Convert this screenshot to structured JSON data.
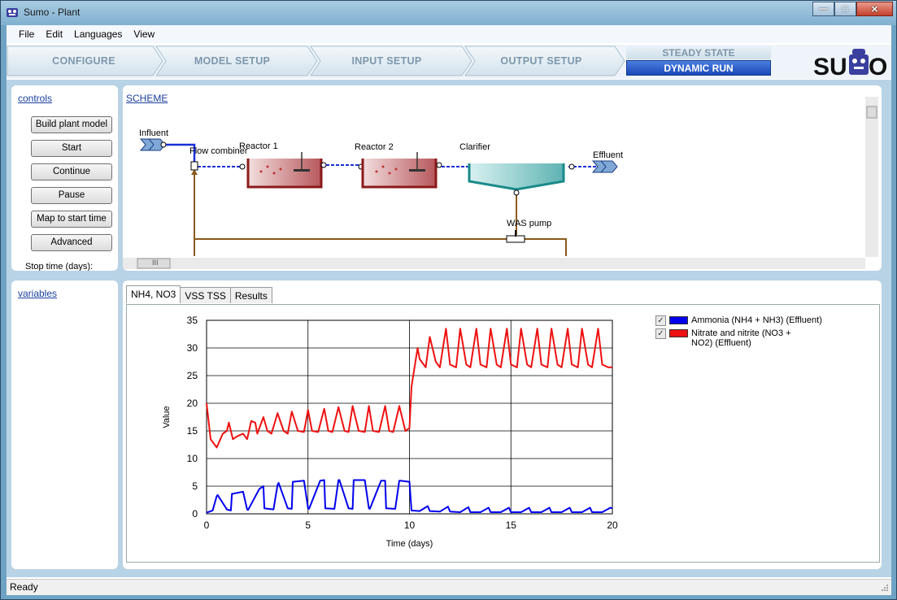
{
  "window": {
    "title": "Sumo - Plant",
    "controls": [
      "minimize",
      "maximize",
      "close"
    ]
  },
  "menu": [
    "File",
    "Edit",
    "Languages",
    "View"
  ],
  "steps": {
    "configure": "CONFIGURE",
    "model_setup": "MODEL SETUP",
    "input_setup": "INPUT SETUP",
    "output_setup": "OUTPUT SETUP",
    "steady_state": "STEADY STATE",
    "dynamic_run": "DYNAMIC RUN"
  },
  "controls": {
    "title": "controls",
    "buttons": [
      "Build plant model",
      "Start",
      "Continue",
      "Pause",
      "Map to start time",
      "Advanced"
    ],
    "stop_time_label": "Stop time (days):"
  },
  "scheme": {
    "title": "SCHEME",
    "labels": {
      "influent": "Influent",
      "flow_combiner": "Flow combiner",
      "reactor1": "Reactor 1",
      "reactor2": "Reactor 2",
      "clarifier": "Clarifier",
      "effluent": "Effluent",
      "was_pump": "WAS pump"
    },
    "scroll_thumb": "III"
  },
  "variables": {
    "title": "variables"
  },
  "plot_tabs": [
    "NH4, NO3",
    "VSS TSS",
    "Results"
  ],
  "colors": {
    "ammonia": "#0000ee",
    "nitrate": "#ee1111",
    "accent": "#1b48b6"
  },
  "chart_data": {
    "type": "line",
    "xlabel": "Time (days)",
    "ylabel": "Value",
    "xlim": [
      0,
      20
    ],
    "ylim": [
      0,
      35
    ],
    "xticks": [
      0,
      5,
      10,
      15,
      20
    ],
    "yticks": [
      0,
      5,
      10,
      15,
      20,
      25,
      30,
      35
    ],
    "grid": true,
    "legend_position": "right",
    "series": [
      {
        "name": "Ammonia (NH4 + NH3) (Effluent)",
        "color": "#0000ee",
        "x": [
          0,
          0.3,
          0.5,
          0.55,
          1.0,
          1.2,
          1.25,
          1.8,
          2.0,
          2.05,
          2.6,
          2.8,
          2.85,
          3.3,
          3.5,
          3.55,
          4.0,
          4.2,
          4.25,
          4.8,
          5.0,
          5.05,
          5.6,
          5.8,
          5.85,
          6.3,
          6.5,
          6.55,
          7.0,
          7.2,
          7.25,
          7.8,
          8.0,
          8.05,
          8.6,
          8.8,
          8.85,
          9.3,
          9.5,
          9.55,
          10.0,
          10.1,
          10.5,
          10.9,
          11.0,
          11.5,
          11.9,
          12.0,
          12.5,
          12.9,
          13.0,
          13.5,
          13.9,
          14.0,
          14.5,
          14.9,
          15.0,
          15.5,
          15.9,
          16.0,
          16.5,
          16.9,
          17.0,
          17.5,
          17.9,
          18.0,
          18.5,
          18.9,
          19.0,
          19.5,
          19.9,
          20.0
        ],
        "y": [
          0.2,
          0.6,
          3.2,
          3.4,
          0.8,
          0.6,
          3.6,
          4.0,
          0.8,
          0.7,
          4.5,
          5.0,
          1.0,
          0.8,
          5.2,
          5.6,
          1.0,
          0.9,
          5.8,
          6.0,
          1.0,
          0.9,
          6.0,
          6.1,
          1.0,
          0.9,
          6.1,
          6.1,
          1.0,
          0.9,
          6.1,
          6.1,
          1.0,
          0.9,
          6.0,
          6.0,
          1.0,
          0.9,
          6.0,
          6.0,
          5.8,
          0.6,
          0.5,
          1.4,
          0.5,
          0.4,
          1.3,
          0.4,
          0.3,
          1.2,
          0.3,
          0.3,
          1.1,
          0.3,
          0.3,
          1.1,
          0.3,
          0.3,
          1.1,
          0.3,
          0.3,
          1.1,
          0.3,
          0.3,
          1.1,
          0.3,
          0.3,
          1.1,
          0.3,
          0.3,
          1.1,
          1.0
        ]
      },
      {
        "name": "Nitrate and nitrite (NO3 + NO2) (Effluent)",
        "color": "#ee1111",
        "x": [
          0,
          0.2,
          0.5,
          0.8,
          1.0,
          1.1,
          1.3,
          1.5,
          1.8,
          2.0,
          2.2,
          2.4,
          2.5,
          2.8,
          3.0,
          3.2,
          3.5,
          3.8,
          4.0,
          4.2,
          4.5,
          4.8,
          5.0,
          5.2,
          5.5,
          5.8,
          6.0,
          6.2,
          6.5,
          6.8,
          7.0,
          7.2,
          7.5,
          7.8,
          8.0,
          8.2,
          8.5,
          8.8,
          9.0,
          9.2,
          9.5,
          9.8,
          10.0,
          10.1,
          10.4,
          10.5,
          10.8,
          11.0,
          11.3,
          11.5,
          11.8,
          12.0,
          12.3,
          12.5,
          12.8,
          13.0,
          13.3,
          13.5,
          13.8,
          14.0,
          14.3,
          14.5,
          14.8,
          15.0,
          15.3,
          15.5,
          15.8,
          16.0,
          16.3,
          16.5,
          16.8,
          17.0,
          17.3,
          17.5,
          17.8,
          18.0,
          18.3,
          18.5,
          18.8,
          19.0,
          19.3,
          19.5,
          19.8,
          20.0
        ],
        "y": [
          20,
          13.5,
          12,
          14.5,
          15,
          16.5,
          13.5,
          14,
          14.5,
          13.5,
          16.8,
          16.5,
          14.5,
          17.5,
          15,
          14.5,
          18.2,
          15,
          14.5,
          18.5,
          15,
          14.8,
          18.8,
          15,
          14.8,
          19,
          15,
          14.8,
          19.3,
          15,
          14.8,
          19.5,
          15,
          14.8,
          19.5,
          15,
          14.8,
          19.5,
          15,
          14.8,
          19.5,
          15,
          15.5,
          23,
          30,
          28,
          26.5,
          32,
          27.5,
          26.5,
          33.5,
          27,
          26.5,
          33.5,
          27,
          26.5,
          33.5,
          27,
          26.5,
          33.5,
          27,
          26.5,
          33.5,
          27,
          26.5,
          33.5,
          27,
          26.5,
          33.5,
          27,
          26.5,
          33.5,
          27,
          26.5,
          33.5,
          27,
          26.5,
          33.5,
          27,
          26.5,
          33.5,
          27,
          26.5,
          26.5
        ]
      }
    ]
  },
  "status": {
    "text": "Ready"
  }
}
